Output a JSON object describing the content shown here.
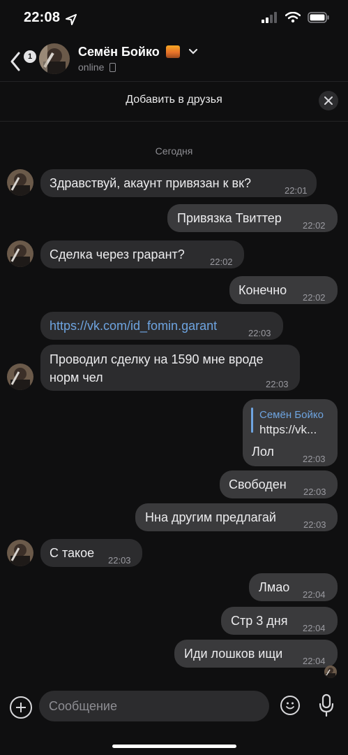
{
  "status": {
    "time": "22:08"
  },
  "header": {
    "back_badge": "1",
    "name": "Семён Бойко",
    "status": "online",
    "flag_icon": "sunset-emoji"
  },
  "add_friend": {
    "label": "Добавить в друзья"
  },
  "date_separator": "Сегодня",
  "messages": [
    {
      "dir": "in",
      "text": "Здравствуй, акаунт привязан к вк?",
      "time": "22:01"
    },
    {
      "dir": "out",
      "text": "Привязка Твиттер",
      "time": "22:02"
    },
    {
      "dir": "in",
      "text": "Сделка через грарант?",
      "time": "22:02"
    },
    {
      "dir": "out",
      "text": "Конечно",
      "time": "22:02"
    },
    {
      "dir": "in",
      "text": "https://vk.com/id_fomin.garant",
      "time": "22:03",
      "link": true
    },
    {
      "dir": "in",
      "line1": "Проводил сделку на 1590 мне вроде",
      "line2": "норм чел",
      "time": "22:03"
    },
    {
      "dir": "out",
      "reply_name": "Семён Бойко",
      "reply_text": "https://vk...",
      "text": "Лол",
      "time": "22:03"
    },
    {
      "dir": "out",
      "text": "Свободен",
      "time": "22:03"
    },
    {
      "dir": "out",
      "text": "Нна другим предлагай",
      "time": "22:03"
    },
    {
      "dir": "in",
      "text": "С такое",
      "time": "22:03"
    },
    {
      "dir": "out",
      "text": "Лмао",
      "time": "22:04"
    },
    {
      "dir": "out",
      "text": "Стр 3 дня",
      "time": "22:04"
    },
    {
      "dir": "out",
      "text": "Иди лошков ищи",
      "time": "22:04"
    }
  ],
  "composer": {
    "placeholder": "Сообщение"
  },
  "colors": {
    "bubble_in": "#2c2c2e",
    "bubble_out": "#3a3a3c",
    "link": "#6ea4e0",
    "background": "#0f0f10"
  }
}
